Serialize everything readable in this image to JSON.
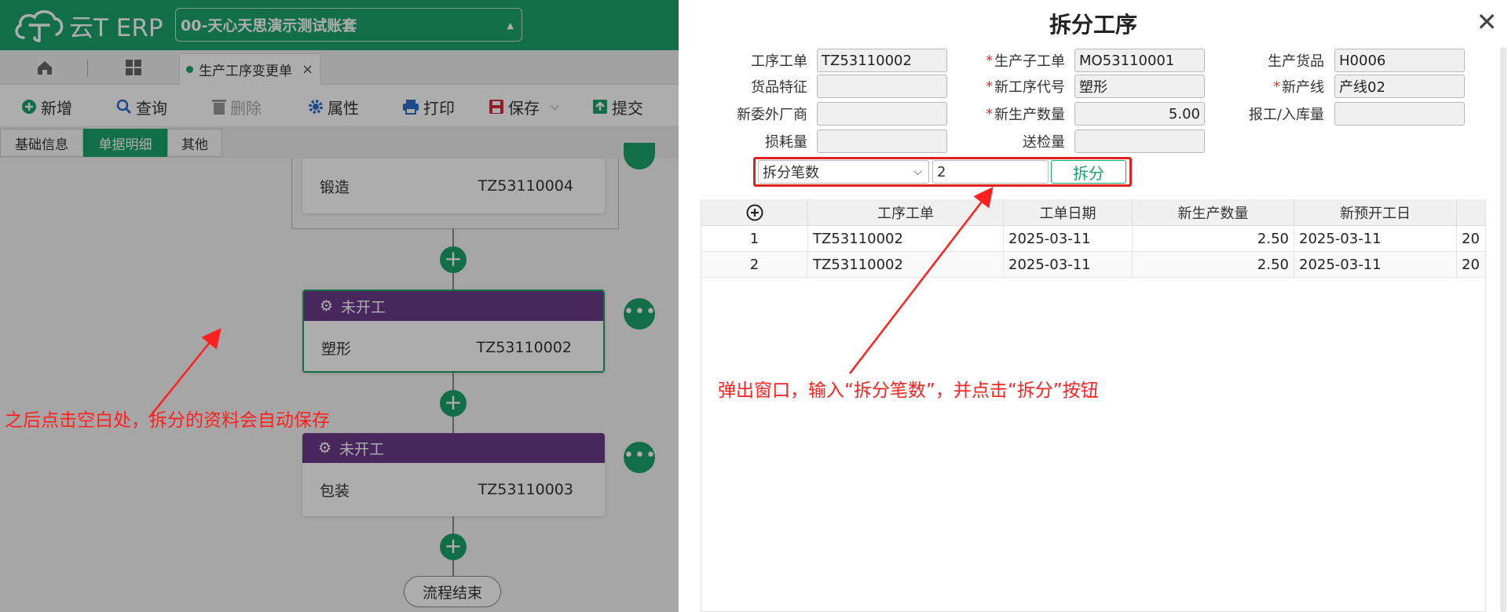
{
  "app": {
    "logo_text": "云T ERP",
    "account": "00-天心天思演示测试账套",
    "open_tab": "生产工序变更单"
  },
  "toolbar": {
    "new": "新增",
    "query": "查询",
    "delete": "删除",
    "properties": "属性",
    "print": "打印",
    "save": "保存",
    "submit": "提交"
  },
  "sub_tabs": [
    "基础信息",
    "单据明细",
    "其他"
  ],
  "flow": {
    "card_top": {
      "name": "锻造",
      "code": "TZ53110004"
    },
    "card_mid": {
      "status": "未开工",
      "name": "塑形",
      "code": "TZ53110002"
    },
    "card_bot": {
      "status": "未开工",
      "name": "包装",
      "code": "TZ53110003"
    },
    "end": "流程结束"
  },
  "left_annotation": "之后点击空白处，拆分的资料会自动保存",
  "dialog": {
    "title": "拆分工序",
    "fields": {
      "process_order": {
        "label": "工序工单",
        "value": "TZ53110002"
      },
      "production_suborder": {
        "label": "生产子工单",
        "value": "MO53110001"
      },
      "production_goods": {
        "label": "生产货品",
        "value": "H0006"
      },
      "goods_feature": {
        "label": "货品特征",
        "value": ""
      },
      "new_process_code": {
        "label": "新工序代号",
        "value": "塑形"
      },
      "new_line": {
        "label": "新产线",
        "value": "产线02"
      },
      "new_outsourcer": {
        "label": "新委外厂商",
        "value": ""
      },
      "new_quantity": {
        "label": "新生产数量",
        "value": "5.00"
      },
      "report_qty": {
        "label": "报工/入库量",
        "value": ""
      },
      "loss_qty": {
        "label": "损耗量",
        "value": ""
      },
      "inspect_qty": {
        "label": "送检量",
        "value": ""
      }
    },
    "split_mode": "拆分笔数",
    "split_count": "2",
    "split_button": "拆分",
    "grid": {
      "columns": [
        "工序工单",
        "工单日期",
        "新生产数量",
        "新预开工日"
      ],
      "rows": [
        {
          "no": "1",
          "order": "TZ53110002",
          "date": "2025-03-11",
          "qty": "2.50",
          "start": "2025-03-11",
          "extra": "20"
        },
        {
          "no": "2",
          "order": "TZ53110002",
          "date": "2025-03-11",
          "qty": "2.50",
          "start": "2025-03-11",
          "extra": "20"
        }
      ]
    },
    "annotation": "弹出窗口，输入“拆分笔数”，并点击“拆分”按钮"
  },
  "colors": {
    "brand": "#1ba36a",
    "card_header": "#6a3a8a",
    "annotation": "#ff2020"
  },
  "icons": [
    "cloud-logo-icon",
    "home-icon",
    "grid-icon",
    "plus-circle-icon",
    "search-icon",
    "trash-icon",
    "gear-icon",
    "printer-icon",
    "save-icon",
    "upload-icon",
    "caret-up-icon",
    "close-icon",
    "chevron-down-icon",
    "more-icon",
    "flow-icon"
  ]
}
